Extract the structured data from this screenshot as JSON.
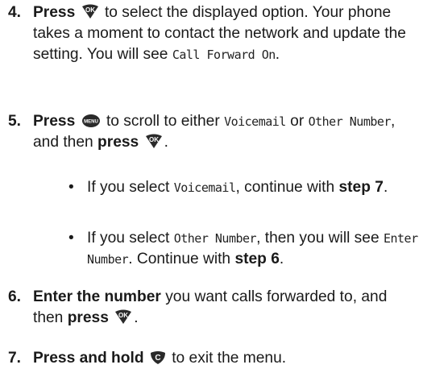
{
  "steps": {
    "s4": {
      "num": "4.",
      "verb": "Press",
      "key_icon": "ok-key-icon",
      "t1": " to select the displayed option. Your phone takes a moment to contact the network and update the setting. You will see ",
      "lcd": "Call Forward On",
      "t2": "."
    },
    "s5": {
      "num": "5.",
      "verb": "Press",
      "key1_icon": "menu-key-icon",
      "t1": " to scroll to either ",
      "lcd1": "Voicemail",
      "t2": " or ",
      "lcd2": "Other Number",
      "t3": ", and then ",
      "verb2": "press",
      "key2_icon": "ok-key-icon",
      "t4": "."
    },
    "bullet1": {
      "dot": "•",
      "t1": "If you select ",
      "lcd": "Voicemail",
      "t2": ", continue with ",
      "step": "step 7",
      "t3": "."
    },
    "bullet2": {
      "dot": "•",
      "t1": "If you select ",
      "lcd1": "Other Number",
      "t2": ", then you will see ",
      "lcd2": "Enter Number",
      "t3": ". Continue with ",
      "step": "step 6",
      "t4": "."
    },
    "s6": {
      "num": "6.",
      "verb": "Enter the number",
      "t1": " you want calls forwarded to, and then ",
      "verb2": "press",
      "key_icon": "ok-key-icon",
      "t2": "."
    },
    "s7": {
      "num": "7.",
      "verb": "Press and hold",
      "key_icon": "clear-key-icon",
      "t1": " to exit the menu."
    }
  },
  "colors": {
    "text": "#1a1a1a",
    "key_fill": "#2a2a2a"
  }
}
